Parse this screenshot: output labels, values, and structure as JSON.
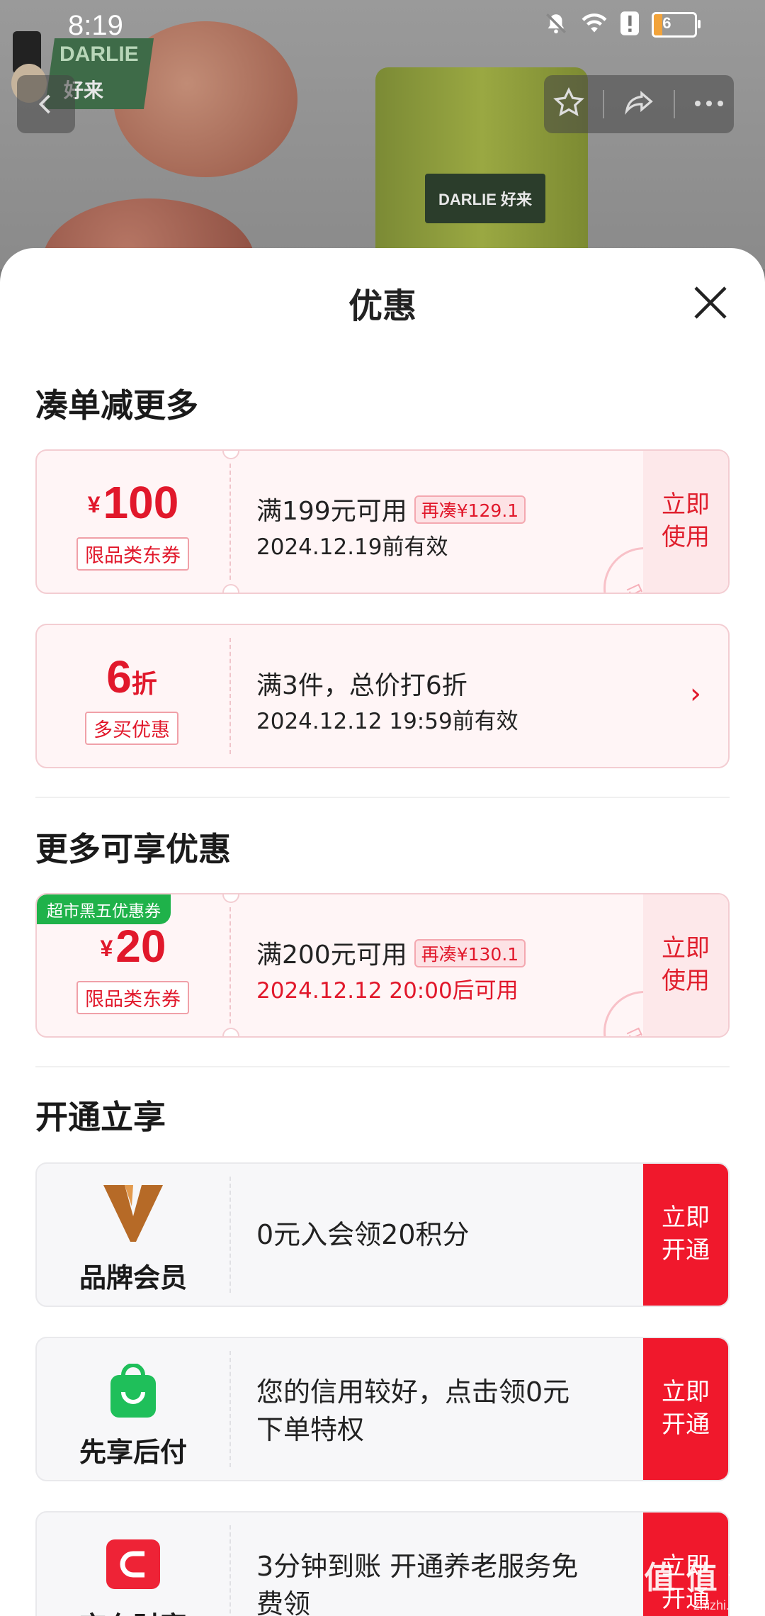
{
  "status_bar": {
    "time": "8:19",
    "battery": "16"
  },
  "banner": {
    "brand_en": "DARLIE",
    "brand_cn": "好来",
    "tube_label": "DARLIE 好来"
  },
  "sheet": {
    "title": "优惠"
  },
  "sections": {
    "s1": "凑单减更多",
    "s2": "更多可享优惠",
    "s3": "开通立享"
  },
  "coupons": [
    {
      "currency": "¥",
      "amount": "100",
      "tag": "限品类东券",
      "condition": "满199元可用",
      "pill": "再凑¥129.1",
      "validity": "2024.12.19前有效",
      "stamp": "已领",
      "action1": "立即",
      "action2": "使用"
    },
    {
      "amount": "6",
      "unit": "折",
      "tag": "多买优惠",
      "condition": "满3件，总价打6折",
      "validity": "2024.12.12 19:59前有效"
    },
    {
      "badge": "超市黑五优惠券",
      "currency": "¥",
      "amount": "20",
      "tag": "限品类东券",
      "condition": "满200元可用",
      "pill": "再凑¥130.1",
      "validity": "2024.12.12 20:00后可用",
      "stamp": "已领",
      "action1": "立即",
      "action2": "使用"
    }
  ],
  "services": [
    {
      "label": "品牌会员",
      "text": "0元入会领20积分",
      "action1": "立即",
      "action2": "开通",
      "icon": "v-brand-icon"
    },
    {
      "label": "先享后付",
      "text1": "您的信用较好，点击领0元",
      "text2": "下单特权",
      "action1": "立即",
      "action2": "开通",
      "icon": "green-bag-icon"
    },
    {
      "label": "京东财富",
      "text1": "3分钟到账 开通养老服务免",
      "text2": "费领",
      "action1": "立即",
      "action2": "开通",
      "icon": "red-wallet-icon"
    }
  ],
  "watermark": {
    "main": "值 值 值",
    "sub": "zhizhi.com"
  }
}
